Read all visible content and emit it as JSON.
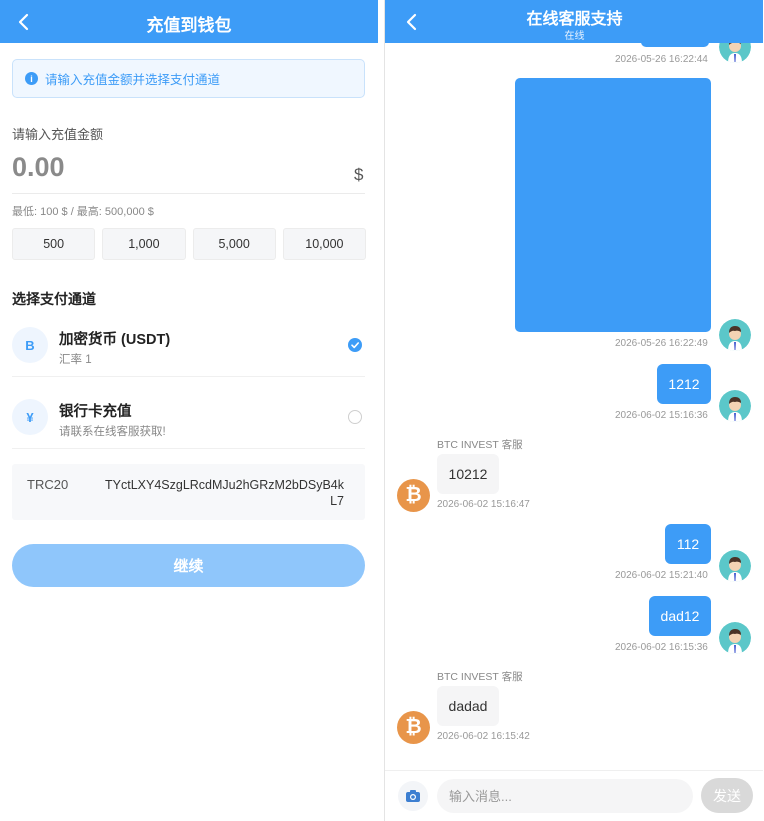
{
  "wallet": {
    "title": "充值到钱包",
    "notice": "请输入充值金额并选择支付通道",
    "amount_label": "请输入充值金额",
    "amount_value": "0.00",
    "amount_unit": "$",
    "amount_range": "最低: 100 $ / 最高: 500,000 $",
    "quick_amounts": [
      "500",
      "1,000",
      "5,000",
      "10,000"
    ],
    "channel_title": "选择支付通道",
    "channels": [
      {
        "icon": "B",
        "name": "加密货币 (USDT)",
        "sub": "汇率 1",
        "selected": true
      },
      {
        "icon": "¥",
        "name": "银行卡充值",
        "sub": "请联系在线客服获取!",
        "selected": false
      }
    ],
    "address": {
      "network": "TRC20",
      "value": "TYctLXY4SzgLRcdMJu2hGRzM2bDSyB4kL7"
    },
    "continue_label": "继续",
    "accent": "#3d9cf7"
  },
  "chat": {
    "title": "在线客服支持",
    "status": "在线",
    "messages": [
      {
        "type": "image",
        "from": "user",
        "time": "2026-05-26 16:22:44"
      },
      {
        "type": "image",
        "from": "user",
        "time": "2026-05-26 16:22:49"
      },
      {
        "type": "text",
        "from": "user",
        "text": "1212",
        "time": "2026-06-02 15:16:36"
      },
      {
        "type": "text",
        "from": "agent",
        "sender": "BTC INVEST 客服",
        "text": "10212",
        "time": "2026-06-02 15:16:47"
      },
      {
        "type": "text",
        "from": "user",
        "text": "112",
        "time": "2026-06-02 15:21:40"
      },
      {
        "type": "text",
        "from": "user",
        "text": "dad12",
        "time": "2026-06-02 16:15:36"
      },
      {
        "type": "text",
        "from": "agent",
        "sender": "BTC INVEST 客服",
        "text": "dadad",
        "time": "2026-06-02 16:15:42"
      }
    ],
    "input_placeholder": "输入消息...",
    "send_label": "发送",
    "agent_avatar_icon": "bitcoin-icon",
    "user_avatar_icon": "user-avatar-icon"
  }
}
